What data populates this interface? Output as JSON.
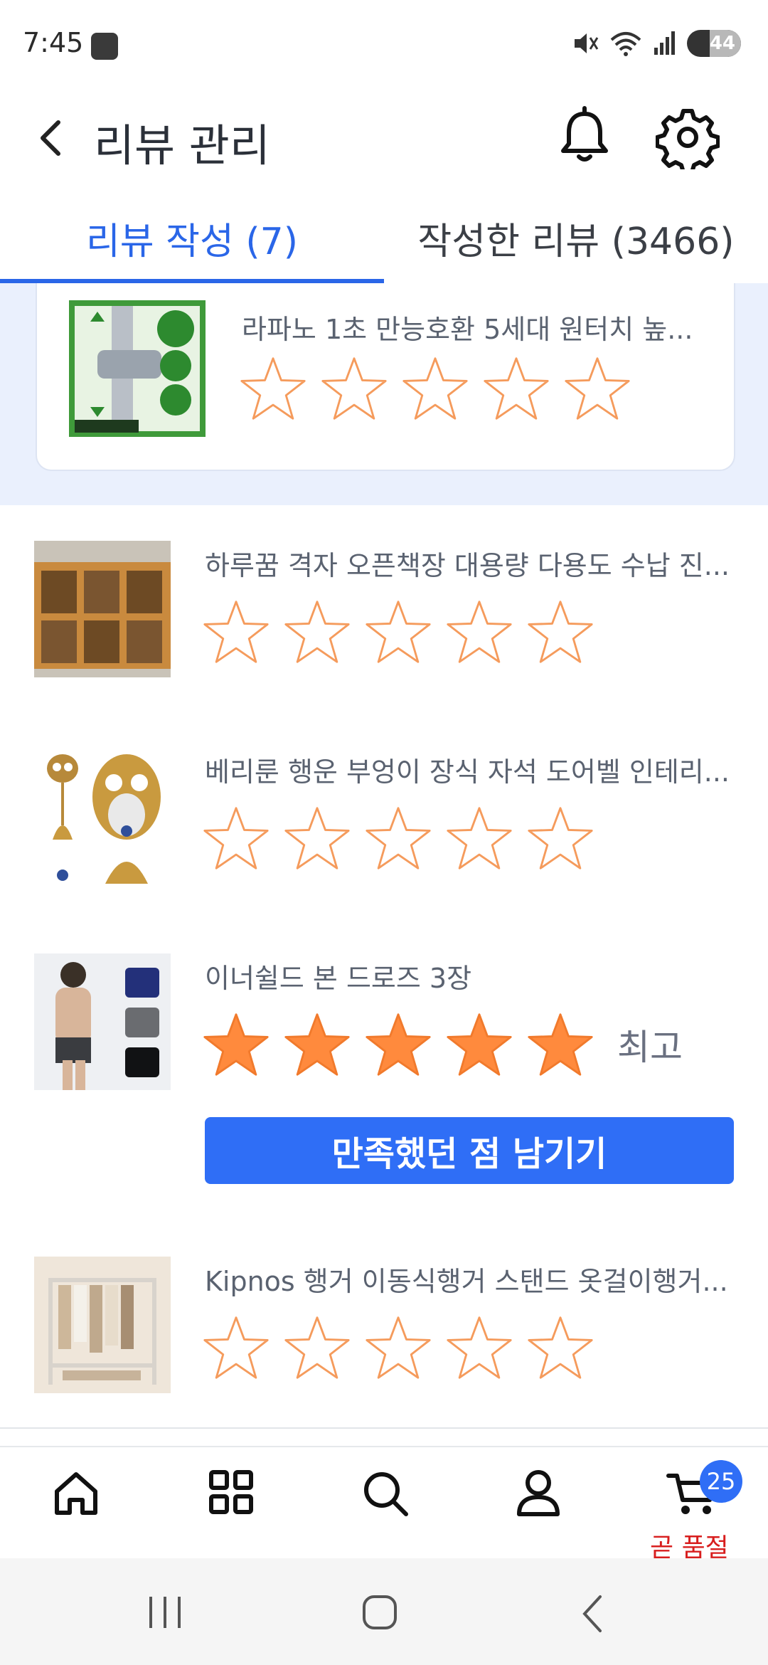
{
  "status_bar": {
    "time": "7:45",
    "battery": "44"
  },
  "header": {
    "title": "리뷰 관리"
  },
  "tabs": [
    {
      "label": "리뷰 작성 (7)",
      "active": true
    },
    {
      "label": "작성한 리뷰 (3466)",
      "active": false
    }
  ],
  "items": [
    {
      "title": "라파노 1초 만능호환 5세대 원터치 높...",
      "rating": 0
    },
    {
      "title": "하루꿈 격자 오픈책장 대용량 다용도 수납 진...",
      "rating": 0
    },
    {
      "title": "베리룬 행운 부엉이 장식 자석 도어벨 인테리...",
      "rating": 0
    },
    {
      "title": "이너쉴드 본 드로즈 3장",
      "rating": 5,
      "rating_label": "최고",
      "cta": "만족했던 점 남기기"
    },
    {
      "title": "Kipnos 행거 이동식행거 스탠드 옷걸이행거...",
      "rating": 0
    }
  ],
  "bottom_nav": {
    "cart_count": "25",
    "cart_note": "곧 품절"
  },
  "colors": {
    "accent": "#2f6ef6",
    "star_outline": "#f59b5c",
    "star_fill": "#ff8a3d",
    "highlight_bg": "#eaf0fd"
  }
}
